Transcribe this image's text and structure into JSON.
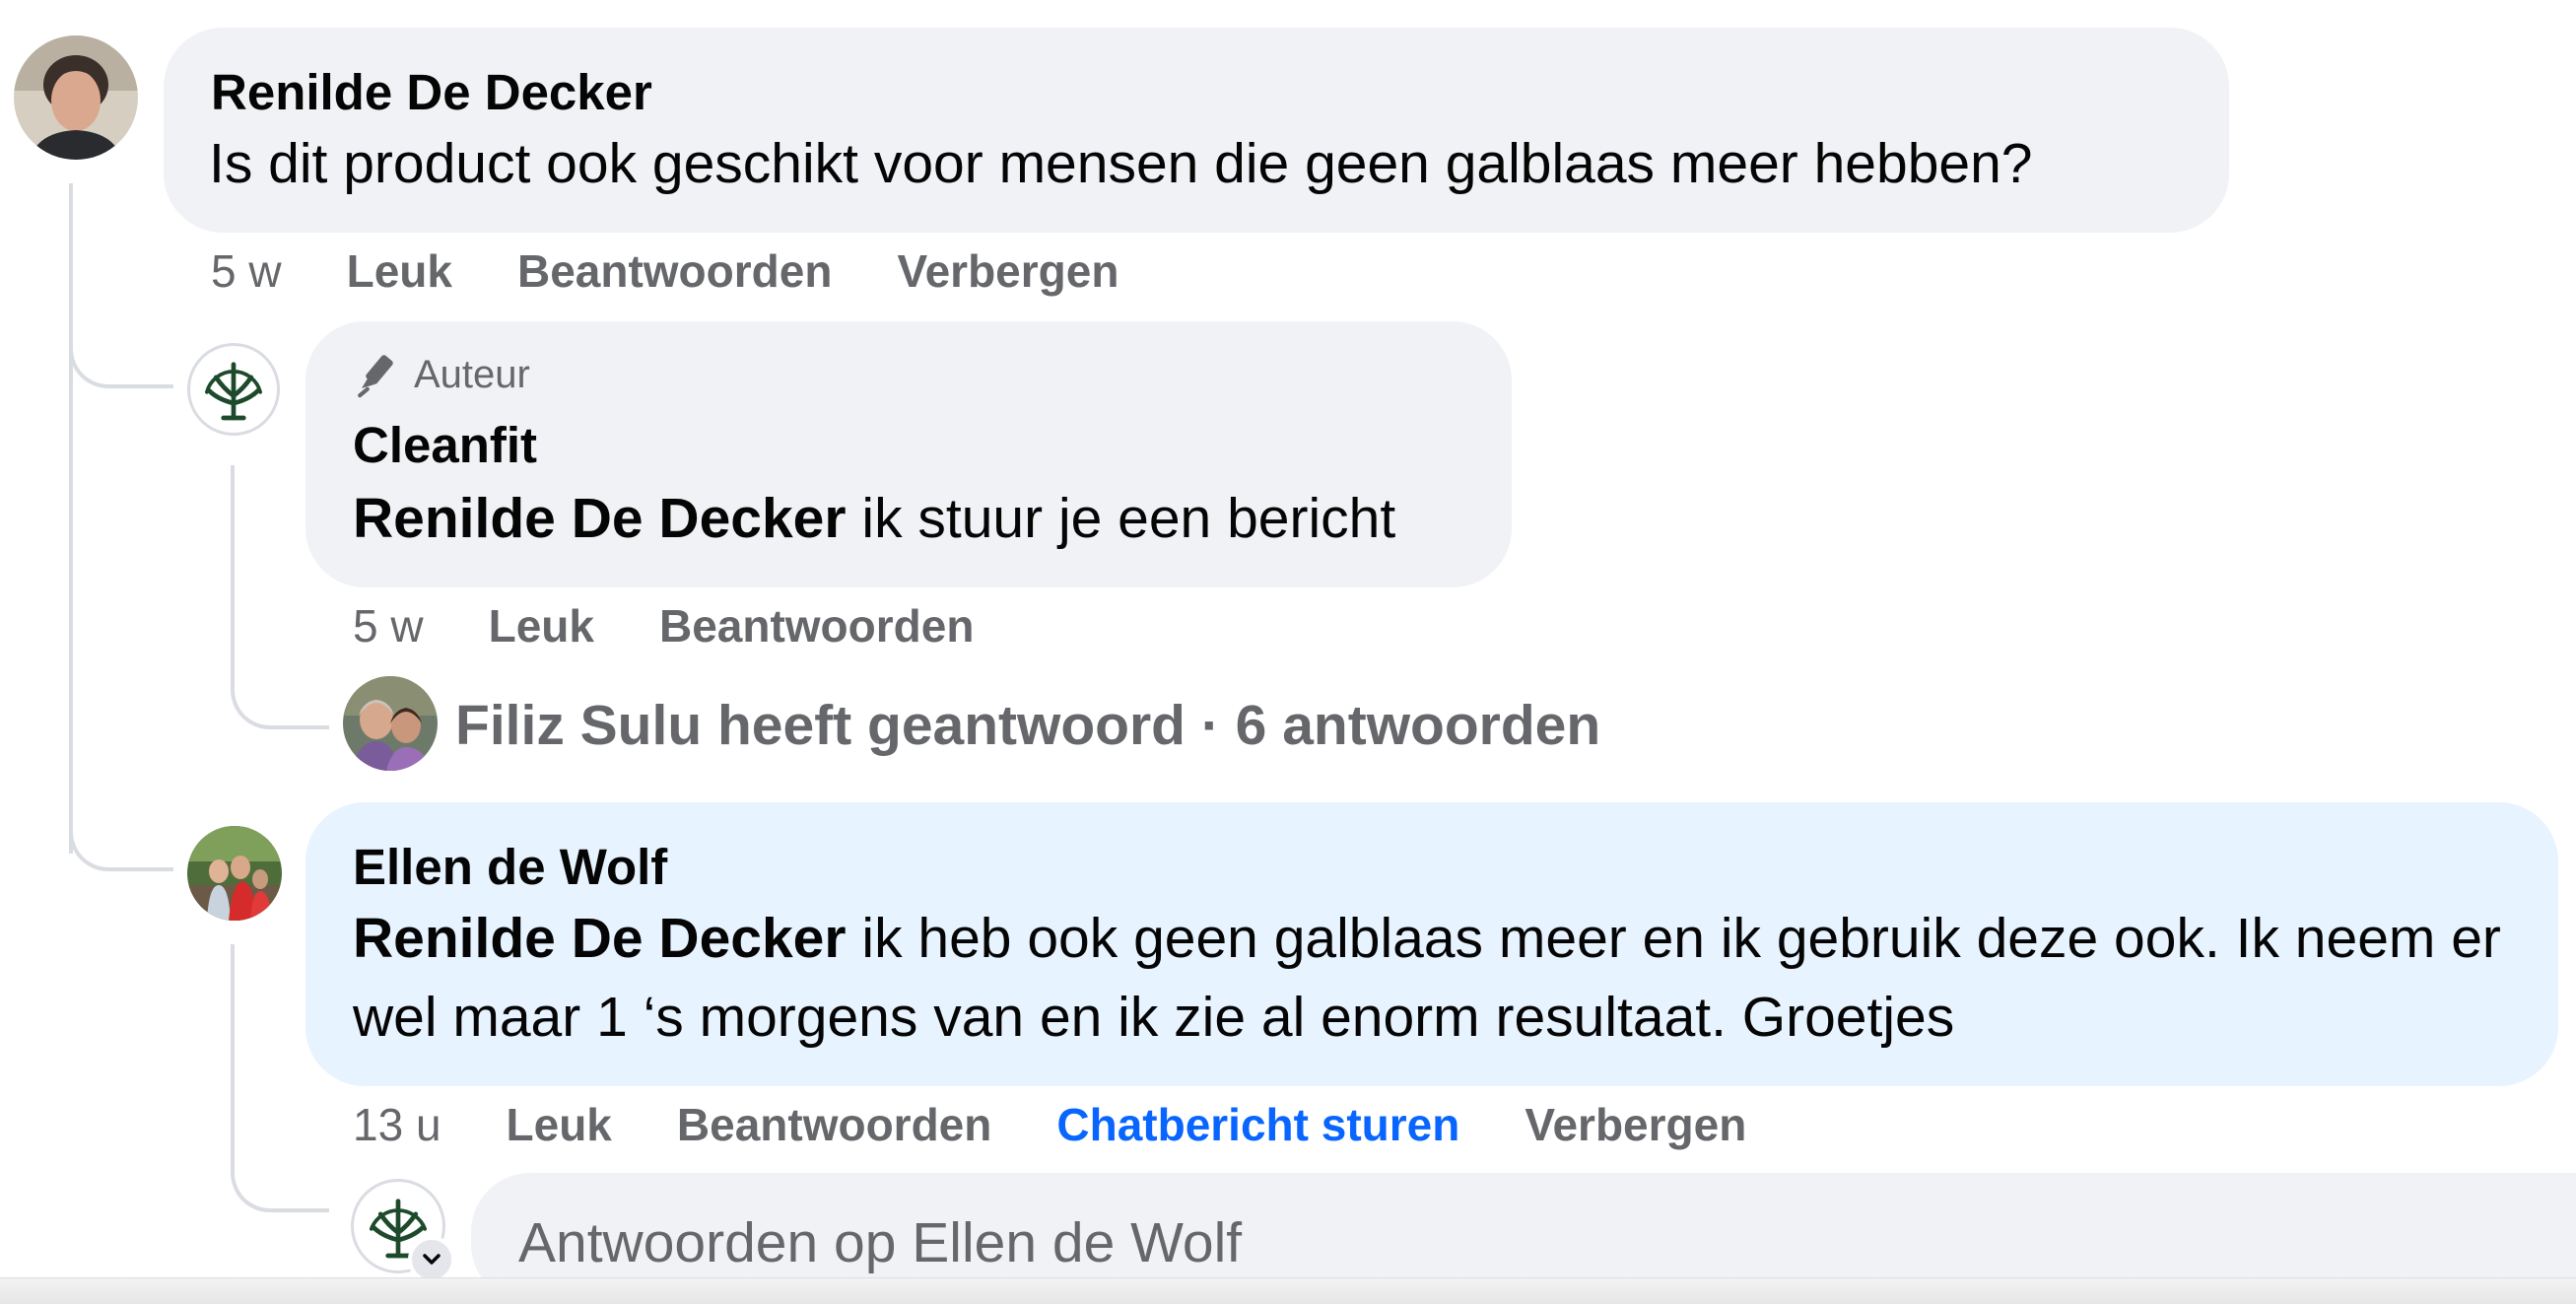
{
  "comments": [
    {
      "author": "Renilde De Decker",
      "text": "Is dit product ook geschikt voor mensen die geen galblaas meer hebben?",
      "time": "5 w",
      "actions": [
        "Leuk",
        "Beantwoorden",
        "Verbergen"
      ]
    },
    {
      "badge": "Auteur",
      "author": "Cleanfit",
      "mention": "Renilde De Decker",
      "text": " ik stuur je een bericht",
      "time": "5 w",
      "actions": [
        "Leuk",
        "Beantwoorden"
      ],
      "replies_summary": "Filiz Sulu heeft geantwoord · 6 antwoorden"
    },
    {
      "author": "Ellen de Wolf",
      "mention": "Renilde De Decker",
      "text": " ik heb ook geen galblaas meer en ik gebruik deze ook. Ik neem er wel maar 1 ‘s morgens van en ik zie al enorm resultaat. Groetjes",
      "time": "13 u",
      "actions": [
        "Leuk",
        "Beantwoorden",
        "Chatbericht sturen",
        "Verbergen"
      ]
    }
  ],
  "reply_box": {
    "placeholder": "Antwoorden op Ellen de Wolf"
  },
  "icons": {
    "author_badge": "pen-icon",
    "brand_logo": "tree-icon",
    "account_switch": "chevron-down-icon"
  },
  "colors": {
    "bubble": "#f0f2f5",
    "bubble_highlight": "#e7f3ff",
    "secondary_text": "#65676b",
    "link_blue": "#0866ff",
    "logo_green": "#1e4a2c"
  }
}
